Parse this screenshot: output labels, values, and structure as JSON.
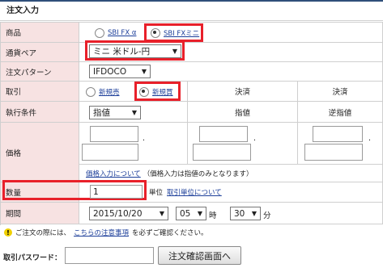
{
  "title": "注文入力",
  "rows": {
    "product": {
      "label": "商品",
      "opt1": "SBI FX α",
      "opt2": "SBI FXミニ"
    },
    "pair": {
      "label": "通貨ペア",
      "value": "ミニ 米ドル-円"
    },
    "pattern": {
      "label": "注文パターン",
      "value": "IFDOCO"
    },
    "trade": {
      "label": "取引",
      "opt1": "新規売",
      "opt2": "新規買",
      "col2": "決済",
      "col3": "決済"
    },
    "condition": {
      "label": "執行条件",
      "value": "指値",
      "col2": "指値",
      "col3": "逆指値"
    },
    "price": {
      "label": "価格",
      "dot": ".",
      "help_link": "価格入力について",
      "help_note": "（価格入力は指値のみとなります）"
    },
    "quantity": {
      "label": "数量",
      "value": "1",
      "unit": "単位",
      "unit_link": "取引単位について"
    },
    "period": {
      "label": "期間",
      "date": "2015/10/20",
      "hour": "05",
      "hour_unit": "時",
      "minute": "30",
      "minute_unit": "分"
    }
  },
  "notice": {
    "pre": "ご注文の際には、",
    "link": "こちらの注意事項",
    "post": "を必ずご確認ください。"
  },
  "password": {
    "label": "取引パスワード：",
    "value": ""
  },
  "submit_label": "注文確認画面へ"
}
